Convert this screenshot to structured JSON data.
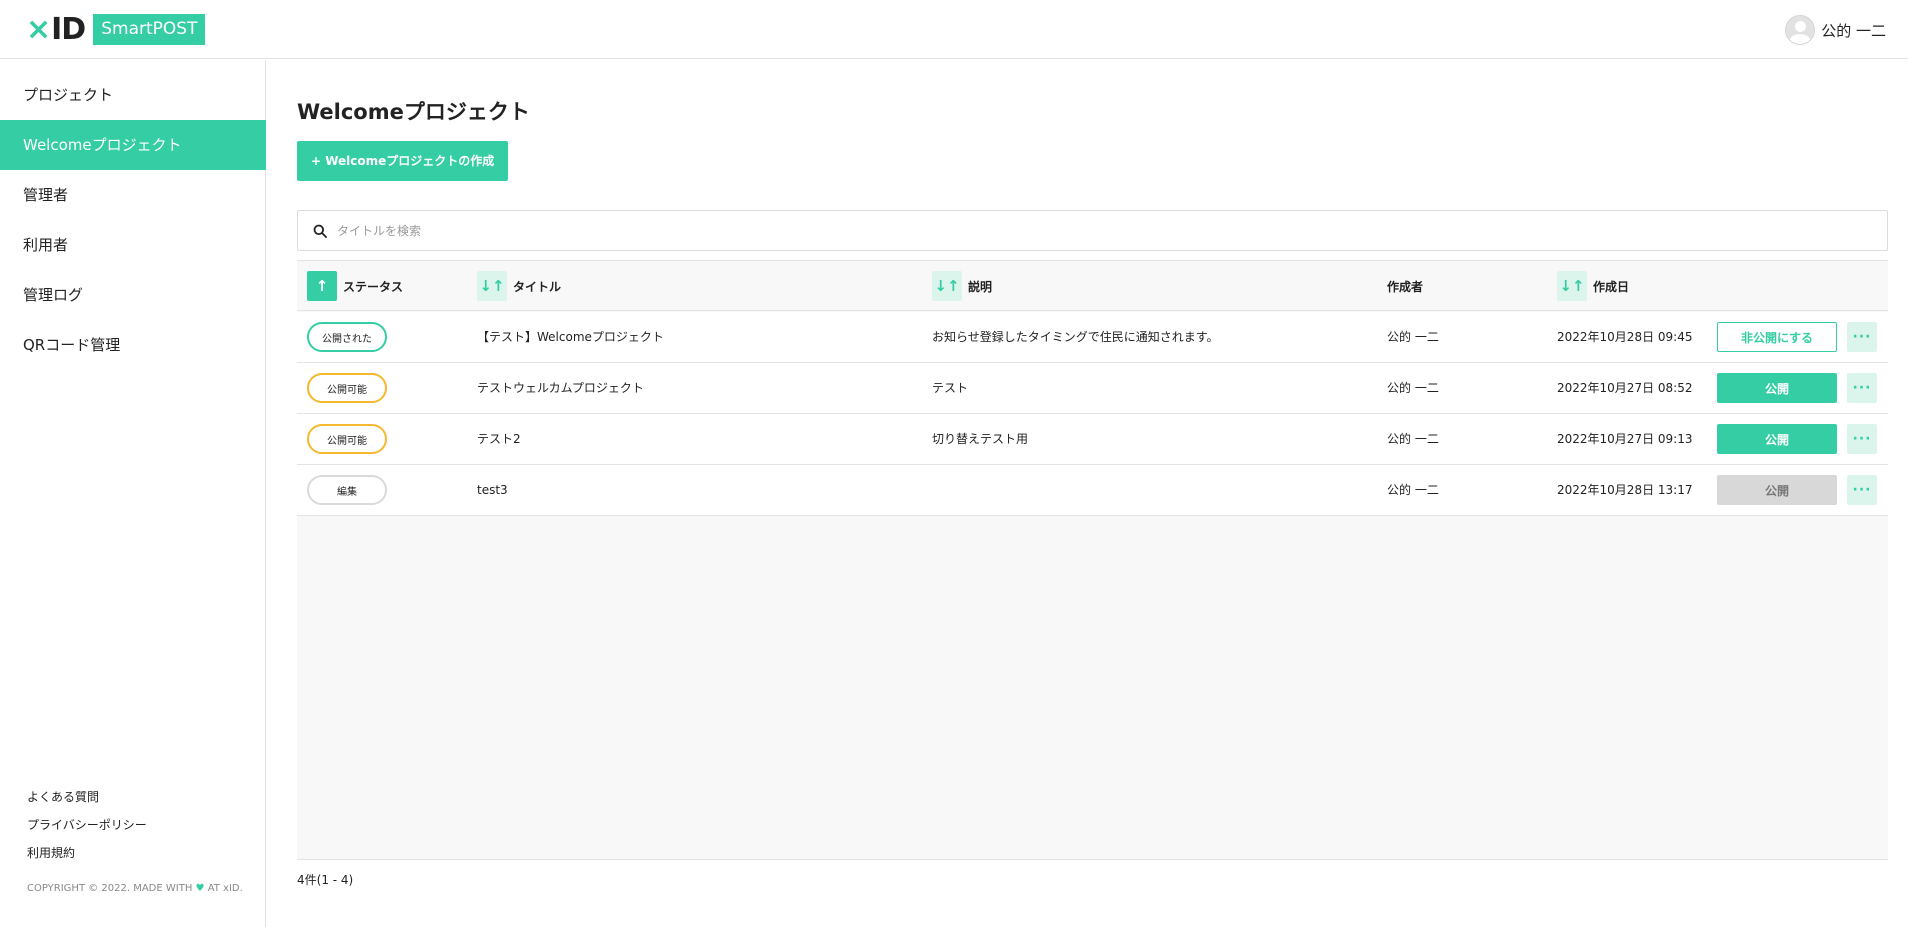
{
  "header": {
    "logo_mark_x": "×",
    "logo_mark_id": "ID",
    "logo_badge": "SmartPOST",
    "user_name": "公的 一二"
  },
  "sidebar": {
    "items": [
      {
        "label": "プロジェクト",
        "active": false
      },
      {
        "label": "Welcomeプロジェクト",
        "active": true
      },
      {
        "label": "管理者",
        "active": false
      },
      {
        "label": "利用者",
        "active": false
      },
      {
        "label": "管理ログ",
        "active": false
      },
      {
        "label": "QRコード管理",
        "active": false
      }
    ],
    "footer_links": [
      "よくある質問",
      "プライバシーポリシー",
      "利用規約"
    ],
    "copyright_prefix": "COPYRIGHT © 2022. MADE WITH",
    "copyright_suffix": "AT xID."
  },
  "main": {
    "title": "Welcomeプロジェクト",
    "create_button": "+ Welcomeプロジェクトの作成",
    "search_placeholder": "タイトルを検索",
    "columns": {
      "status": "ステータス",
      "title": "タイトル",
      "description": "説明",
      "author": "作成者",
      "created": "作成日"
    },
    "rows": [
      {
        "status": "公開された",
        "status_type": "published",
        "title": "【テスト】Welcomeプロジェクト",
        "description": "お知らせ登録したタイミングで住民に通知されます。",
        "author": "公的 一二",
        "created": "2022年10月28日 09:45",
        "action": "非公開にする",
        "action_type": "outline"
      },
      {
        "status": "公開可能",
        "status_type": "ready",
        "title": "テストウェルカムプロジェクト",
        "description": "テスト",
        "author": "公的 一二",
        "created": "2022年10月27日 08:52",
        "action": "公開",
        "action_type": "solid"
      },
      {
        "status": "公開可能",
        "status_type": "ready",
        "title": "テスト2",
        "description": "切り替えテスト用",
        "author": "公的 一二",
        "created": "2022年10月27日 09:13",
        "action": "公開",
        "action_type": "solid"
      },
      {
        "status": "編集",
        "status_type": "edit",
        "title": "test3",
        "description": "",
        "author": "公的 一二",
        "created": "2022年10月28日 13:17",
        "action": "公開",
        "action_type": "disabled"
      }
    ],
    "more_label": "···",
    "count_text": "4件(1 - 4)"
  },
  "colors": {
    "accent": "#35cda3",
    "accent_light": "#dcf5ec",
    "warning": "#f5b82e",
    "border": "#e3e3e3"
  }
}
